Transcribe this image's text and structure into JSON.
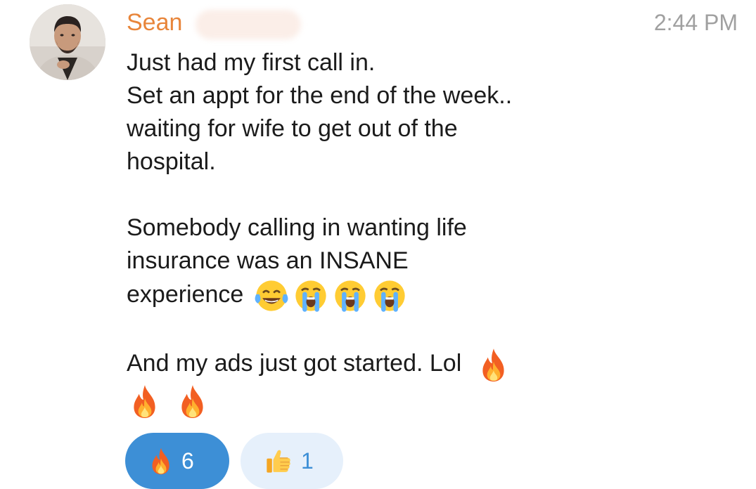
{
  "message": {
    "sender_name": "Sean",
    "time": "2:44 PM",
    "lines": [
      "Just had my first call in.",
      "Set an appt for the end of the week..",
      "waiting for wife to get out of the",
      "hospital."
    ],
    "para2_lines": [
      "Somebody calling in wanting life",
      "insurance was an INSANE",
      "experience"
    ],
    "para2_emojis": [
      "tears-of-joy-emoji",
      "crying-face-emoji",
      "crying-face-emoji",
      "crying-face-emoji"
    ],
    "para3_line": "And my ads just got started. Lol",
    "para3_emojis": [
      "fire-emoji",
      "fire-emoji",
      "fire-emoji"
    ]
  },
  "reactions": [
    {
      "icon": "fire-emoji",
      "count": "6",
      "active": true
    },
    {
      "icon": "thumbs-up-emoji",
      "count": "1",
      "active": false
    }
  ],
  "colors": {
    "sender_name": "#e8853a",
    "text": "#1b1b1b",
    "time": "#a0a0a0",
    "reaction_active": "#3d8fd6",
    "reaction_inactive": "#e6f0fb"
  }
}
